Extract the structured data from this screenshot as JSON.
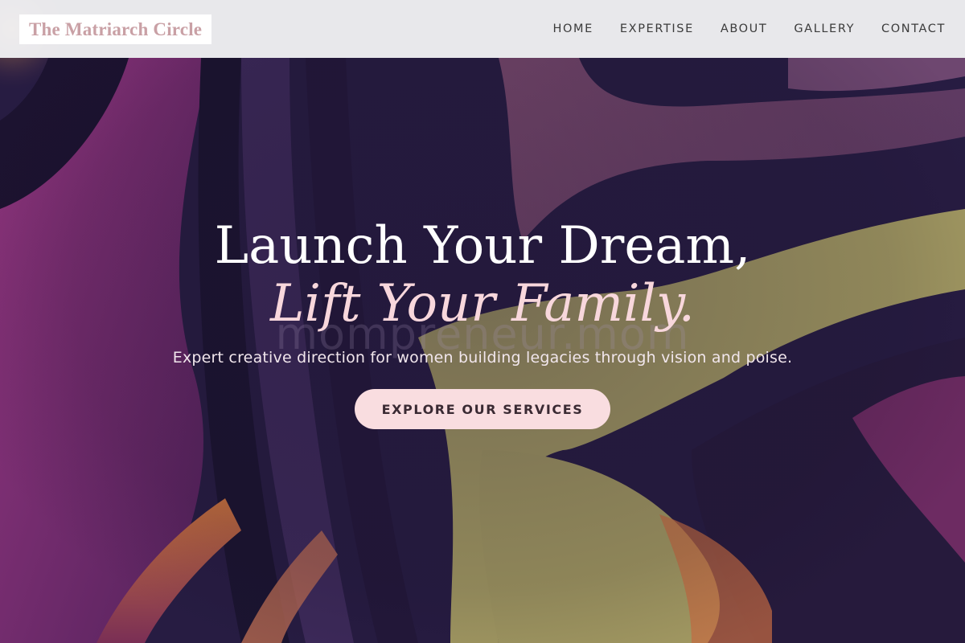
{
  "header": {
    "logo_text": "The Matriarch Circle",
    "nav": [
      "HOME",
      "EXPERTISE",
      "ABOUT",
      "GALLERY",
      "CONTACT"
    ]
  },
  "hero": {
    "title_line1": "Launch Your Dream,",
    "title_line2": "Lift Your Family.",
    "subtitle": "Expert creative direction for women building legacies through vision and poise.",
    "cta_label": "EXPLORE OUR SERVICES",
    "watermark": "mompreneur.mom"
  },
  "colors": {
    "logo": "#c9a0a5",
    "header_bg": "#f0f0f2",
    "title_accent": "#f8d7dc",
    "cta_bg": "#f9dde0",
    "bg_purple": "#2a1f45",
    "bg_magenta": "#8a2f78",
    "bg_olive": "#a59c63"
  }
}
